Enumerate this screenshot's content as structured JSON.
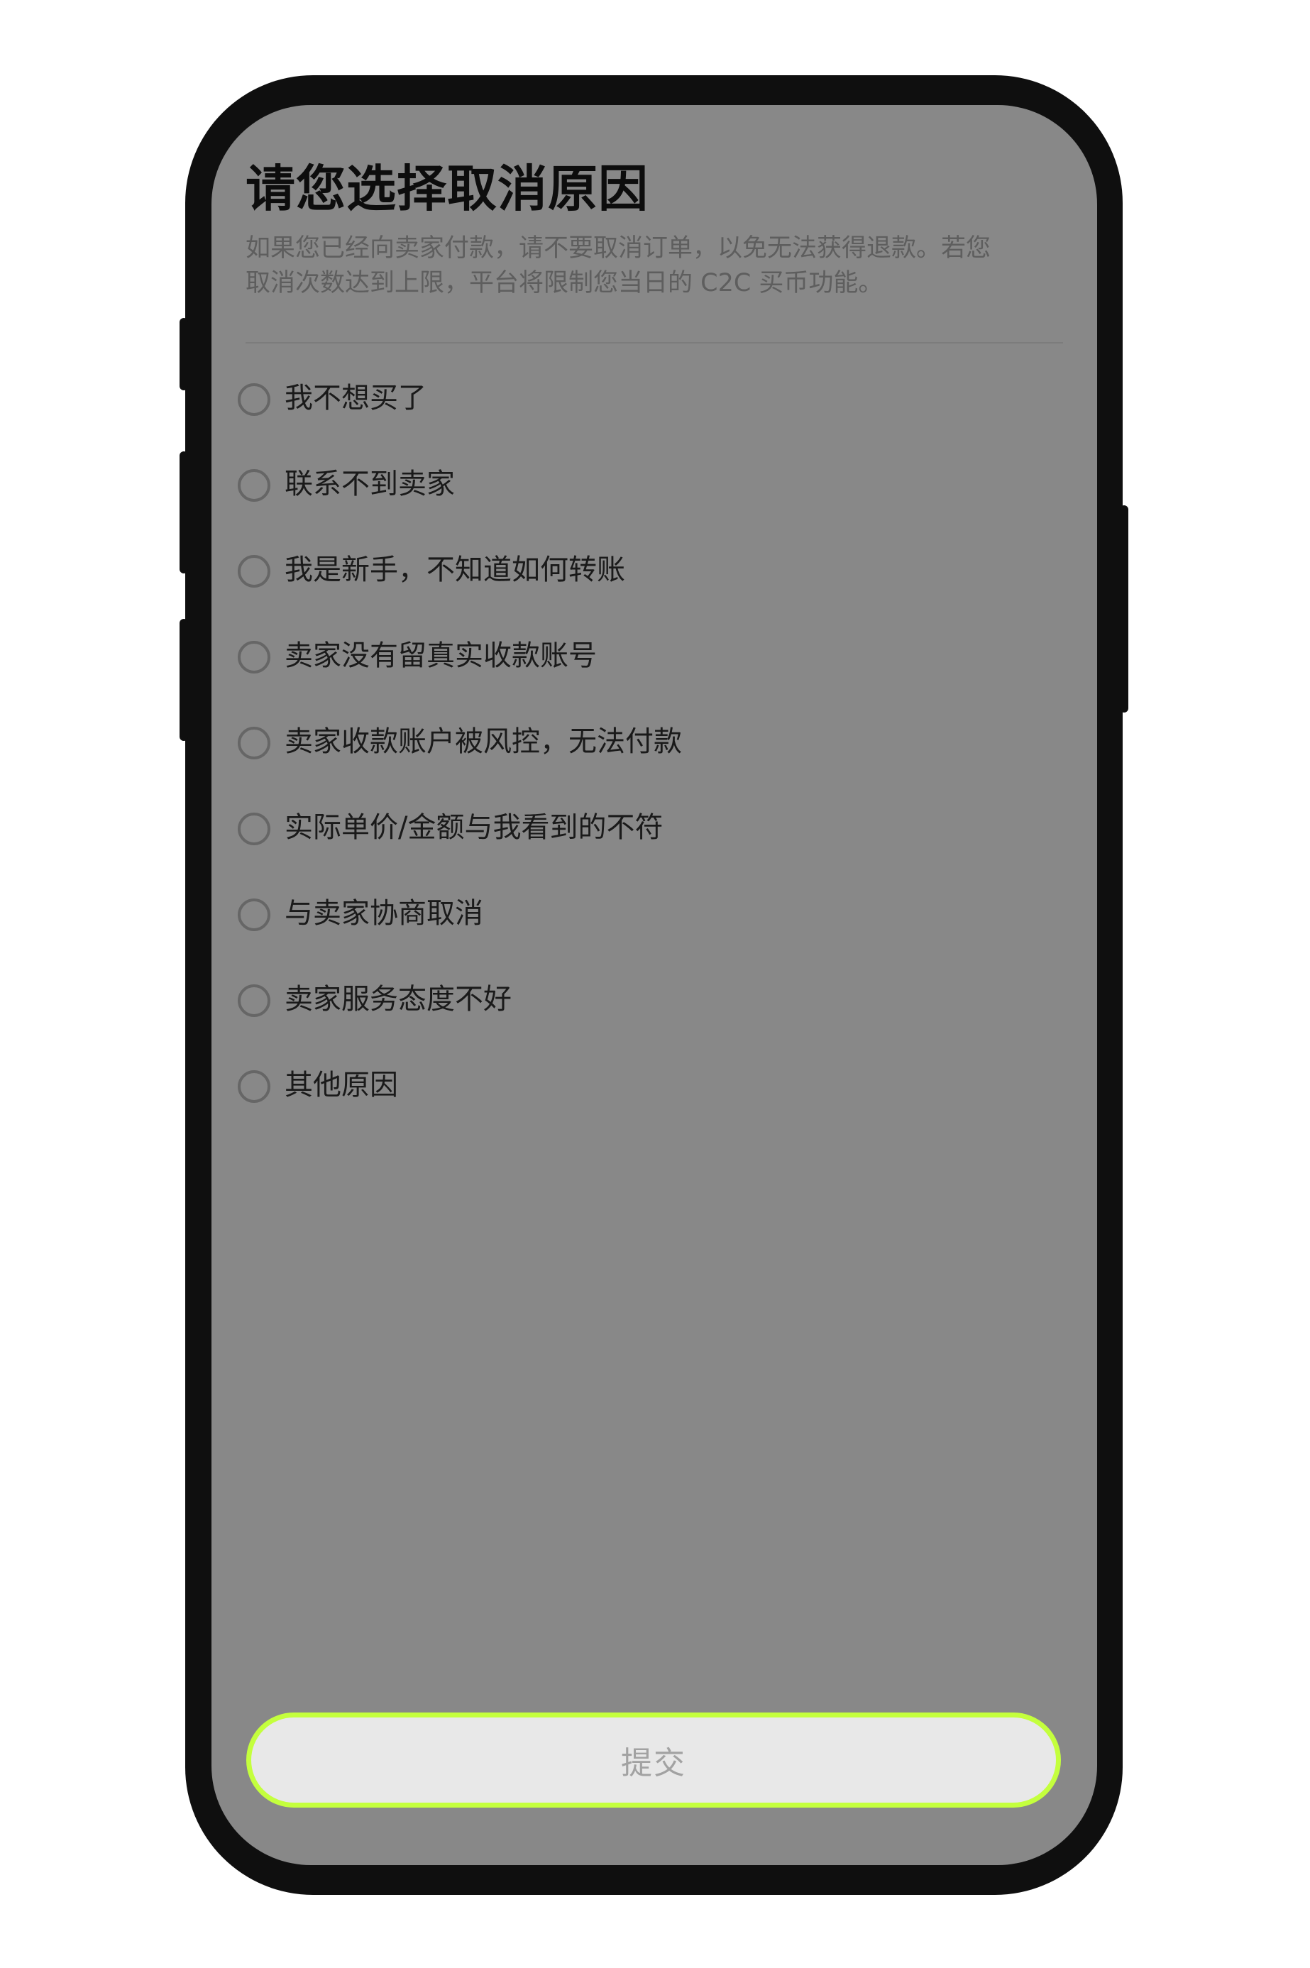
{
  "header": {
    "title": "请您选择取消原因",
    "notice": "如果您已经向卖家付款，请不要取消订单，以免无法获得退款。若您取消次数达到上限，平台将限制您当日的 C2C 买币功能。"
  },
  "options": [
    {
      "label": "我不想买了",
      "selected": false
    },
    {
      "label": "联系不到卖家",
      "selected": false
    },
    {
      "label": "我是新手，不知道如何转账",
      "selected": false
    },
    {
      "label": "卖家没有留真实收款账号",
      "selected": false
    },
    {
      "label": "卖家收款账户被风控，无法付款",
      "selected": false
    },
    {
      "label": "实际单价/金额与我看到的不符",
      "selected": false
    },
    {
      "label": "与卖家协商取消",
      "selected": false
    },
    {
      "label": "卖家服务态度不好",
      "selected": false
    },
    {
      "label": "其他原因",
      "selected": false
    }
  ],
  "footer": {
    "submit_label": "提交"
  },
  "colors": {
    "overlay": "#888888",
    "frame": "#0f0f0f",
    "button_border": "#c4ff3d",
    "button_bg": "#e8e8e8"
  }
}
